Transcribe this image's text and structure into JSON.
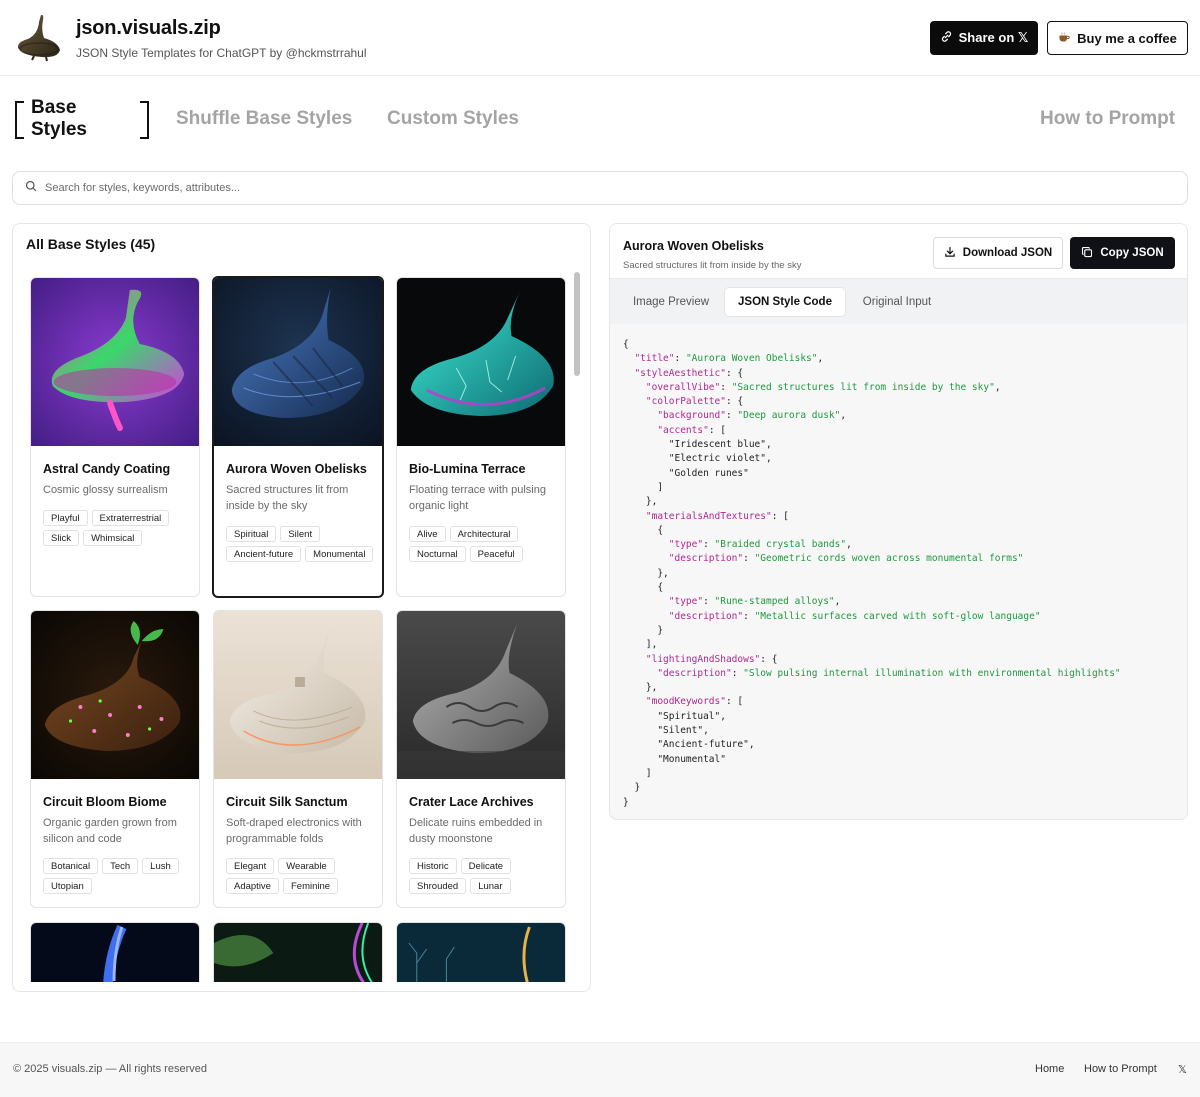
{
  "header": {
    "site_title": "json.visuals.zip",
    "subtitle": "JSON Style Templates for ChatGPT by @hckmstrrahul",
    "share_label": "Share on 𝕏",
    "coffee_label": "Buy me a coffee"
  },
  "tabs": {
    "base": "Base Styles",
    "shuffle": "Shuffle Base Styles",
    "custom": "Custom Styles",
    "how": "How to Prompt",
    "active": "base"
  },
  "search": {
    "placeholder": "Search for styles, keywords, attributes..."
  },
  "gallery": {
    "heading": "All Base Styles (45)",
    "cards": [
      {
        "title": "Astral Candy Coating",
        "desc": "Cosmic glossy surrealism",
        "tags": [
          "Playful",
          "Extraterrestrial",
          "Slick",
          "Whimsical"
        ],
        "image": "magenta-neon-spinning-top"
      },
      {
        "title": "Aurora Woven Obelisks",
        "desc": "Sacred structures lit from inside by the sky",
        "tags": [
          "Spiritual",
          "Silent",
          "Ancient-future",
          "Monumental"
        ],
        "image": "braided-blue-rune-top",
        "selected": true
      },
      {
        "title": "Bio-Lumina Terrace",
        "desc": "Floating terrace with pulsing organic light",
        "tags": [
          "Alive",
          "Architectural",
          "Nocturnal",
          "Peaceful"
        ],
        "image": "cyan-vein-glowing-top"
      },
      {
        "title": "Circuit Bloom Biome",
        "desc": "Organic garden grown from silicon and code",
        "tags": [
          "Botanical",
          "Tech",
          "Lush",
          "Utopian"
        ],
        "image": "circuit-garden-top"
      },
      {
        "title": "Circuit Silk Sanctum",
        "desc": "Soft-draped electronics with programmable folds",
        "tags": [
          "Elegant",
          "Wearable",
          "Adaptive",
          "Feminine"
        ],
        "image": "white-silk-circuit-top"
      },
      {
        "title": "Crater Lace Archives",
        "desc": "Delicate ruins embedded in dusty moonstone",
        "tags": [
          "Historic",
          "Delicate",
          "Shrouded",
          "Lunar"
        ],
        "image": "grey-moonstone-top"
      }
    ]
  },
  "detail": {
    "title": "Aurora Woven Obelisks",
    "subtitle": "Sacred structures lit from inside by the sky",
    "download_label": "Download JSON",
    "copy_label": "Copy JSON",
    "subtabs": [
      "Image Preview",
      "JSON Style Code",
      "Original Input"
    ],
    "active_subtab": "JSON Style Code",
    "code_lines": [
      [
        [
          "p",
          "{"
        ]
      ],
      [
        [
          "p",
          "  "
        ],
        [
          "k",
          "\"title\""
        ],
        [
          "p",
          ": "
        ],
        [
          "s",
          "\"Aurora Woven Obelisks\""
        ],
        [
          "p",
          ","
        ]
      ],
      [
        [
          "p",
          "  "
        ],
        [
          "k",
          "\"styleAesthetic\""
        ],
        [
          "p",
          ": {"
        ]
      ],
      [
        [
          "p",
          "    "
        ],
        [
          "k",
          "\"overallVibe\""
        ],
        [
          "p",
          ": "
        ],
        [
          "s",
          "\"Sacred structures lit from inside by the sky\""
        ],
        [
          "p",
          ","
        ]
      ],
      [
        [
          "p",
          "    "
        ],
        [
          "k",
          "\"colorPalette\""
        ],
        [
          "p",
          ": {"
        ]
      ],
      [
        [
          "p",
          "      "
        ],
        [
          "k",
          "\"background\""
        ],
        [
          "p",
          ": "
        ],
        [
          "s",
          "\"Deep aurora dusk\""
        ],
        [
          "p",
          ","
        ]
      ],
      [
        [
          "p",
          "      "
        ],
        [
          "k",
          "\"accents\""
        ],
        [
          "p",
          ": ["
        ]
      ],
      [
        [
          "p",
          "        \"Iridescent blue\","
        ]
      ],
      [
        [
          "p",
          "        \"Electric violet\","
        ]
      ],
      [
        [
          "p",
          "        \"Golden runes\""
        ]
      ],
      [
        [
          "p",
          "      ]"
        ]
      ],
      [
        [
          "p",
          "    },"
        ]
      ],
      [
        [
          "p",
          "    "
        ],
        [
          "k",
          "\"materialsAndTextures\""
        ],
        [
          "p",
          ": ["
        ]
      ],
      [
        [
          "p",
          "      {"
        ]
      ],
      [
        [
          "p",
          "        "
        ],
        [
          "k",
          "\"type\""
        ],
        [
          "p",
          ": "
        ],
        [
          "s",
          "\"Braided crystal bands\""
        ],
        [
          "p",
          ","
        ]
      ],
      [
        [
          "p",
          "        "
        ],
        [
          "k",
          "\"description\""
        ],
        [
          "p",
          ": "
        ],
        [
          "s",
          "\"Geometric cords woven across monumental forms\""
        ]
      ],
      [
        [
          "p",
          "      },"
        ]
      ],
      [
        [
          "p",
          "      {"
        ]
      ],
      [
        [
          "p",
          "        "
        ],
        [
          "k",
          "\"type\""
        ],
        [
          "p",
          ": "
        ],
        [
          "s",
          "\"Rune-stamped alloys\""
        ],
        [
          "p",
          ","
        ]
      ],
      [
        [
          "p",
          "        "
        ],
        [
          "k",
          "\"description\""
        ],
        [
          "p",
          ": "
        ],
        [
          "s",
          "\"Metallic surfaces carved with soft-glow language\""
        ]
      ],
      [
        [
          "p",
          "      }"
        ]
      ],
      [
        [
          "p",
          "    ],"
        ]
      ],
      [
        [
          "p",
          "    "
        ],
        [
          "k",
          "\"lightingAndShadows\""
        ],
        [
          "p",
          ": {"
        ]
      ],
      [
        [
          "p",
          "      "
        ],
        [
          "k",
          "\"description\""
        ],
        [
          "p",
          ": "
        ],
        [
          "s",
          "\"Slow pulsing internal illumination with environmental highlights\""
        ]
      ],
      [
        [
          "p",
          "    },"
        ]
      ],
      [
        [
          "p",
          "    "
        ],
        [
          "k",
          "\"moodKeywords\""
        ],
        [
          "p",
          ": ["
        ]
      ],
      [
        [
          "p",
          "      \"Spiritual\","
        ]
      ],
      [
        [
          "p",
          "      \"Silent\","
        ]
      ],
      [
        [
          "p",
          "      \"Ancient-future\","
        ]
      ],
      [
        [
          "p",
          "      \"Monumental\""
        ]
      ],
      [
        [
          "p",
          "    ]"
        ]
      ],
      [
        [
          "p",
          "  }"
        ]
      ],
      [
        [
          "p",
          "}"
        ]
      ]
    ]
  },
  "footer": {
    "copyright": "© 2025 visuals.zip — All rights reserved",
    "links": [
      "Home",
      "How to Prompt",
      "𝕏"
    ]
  },
  "colors": {
    "accent": "#0b0b0b",
    "json_key": "#b4278f",
    "json_string": "#1e9a3e"
  }
}
